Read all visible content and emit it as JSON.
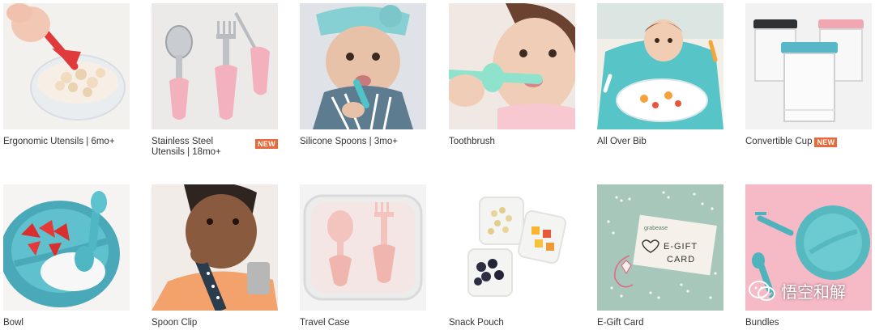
{
  "products_row1": [
    {
      "label": "Ergonomic Utensils | 6mo+",
      "badge": ""
    },
    {
      "label": "Stainless Steel Utensils | 18mo+",
      "badge": "NEW"
    },
    {
      "label": "Silicone Spoons | 3mo+",
      "badge": ""
    },
    {
      "label": "Toothbrush",
      "badge": ""
    },
    {
      "label": "All Over Bib",
      "badge": ""
    },
    {
      "label": "Convertible Cup",
      "badge": "NEW"
    }
  ],
  "products_row2": [
    {
      "label": "Bowl",
      "badge": ""
    },
    {
      "label": "Spoon Clip",
      "badge": ""
    },
    {
      "label": "Travel Case",
      "badge": ""
    },
    {
      "label": "Snack Pouch",
      "badge": ""
    },
    {
      "label": "E-Gift Card",
      "badge": ""
    },
    {
      "label": "Bundles",
      "badge": ""
    }
  ],
  "gift_card": {
    "line1": "E-GIFT",
    "line2": "CARD",
    "brand": "grabease"
  },
  "watermark": {
    "text": "悟空和解"
  },
  "colors": {
    "badge": "#e86a3a",
    "accent_teal": "#4fc3c7",
    "accent_pink": "#f2a7b5"
  }
}
